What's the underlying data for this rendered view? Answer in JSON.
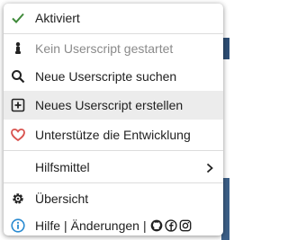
{
  "menu": {
    "enabled_label": "Aktiviert",
    "no_script_label": "Kein Userscript gestartet",
    "search_label": "Neue Userscripte suchen",
    "create_label": "Neues Userscript erstellen",
    "support_label": "Unterstütze die Entwicklung",
    "tools_label": "Hilfsmittel",
    "overview_label": "Übersicht",
    "help_label": "Hilfe",
    "separator": "|",
    "changes_label": "Änderungen"
  },
  "colors": {
    "check": "#3f8a3a",
    "heart": "#d9534f",
    "info": "#2a8bd1",
    "dark": "#222222"
  },
  "icons": {
    "enabled": "check-icon",
    "no_script": "tampermonkey-icon",
    "search": "search-icon",
    "create": "plus-square-icon",
    "support": "heart-icon",
    "tools": "chevron-right-icon",
    "overview": "gear-icon",
    "help": "info-icon",
    "github": "github-icon",
    "facebook": "facebook-icon",
    "instagram": "instagram-icon"
  }
}
